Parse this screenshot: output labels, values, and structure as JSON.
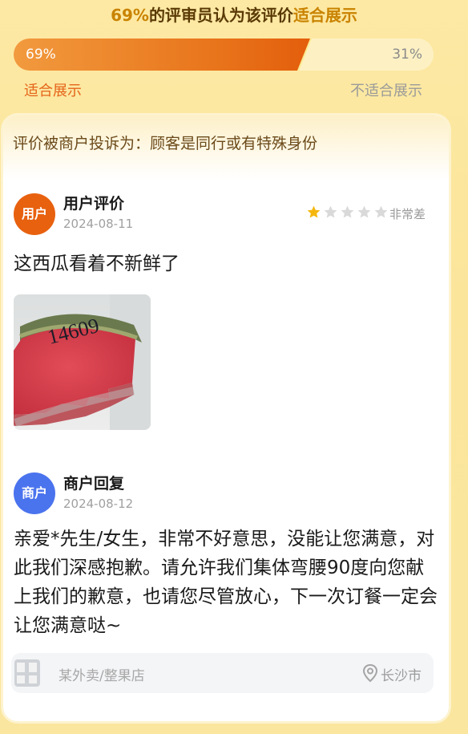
{
  "header": {
    "percent": "69%",
    "text": "的评审员认为该评价",
    "verdict": "适合展示"
  },
  "vote": {
    "suitable_percent": "69%",
    "unsuitable_percent": "31%",
    "suitable_fraction": 0.69,
    "suitable_label": "适合展示",
    "unsuitable_label": "不适合展示"
  },
  "card": {
    "complaint_text": "评价被商户投诉为：顾客是同行或有特殊身份",
    "review": {
      "avatar_label": "用户",
      "title": "用户评价",
      "date": "2024-08-11",
      "rating_stars": 1,
      "rating_max": 5,
      "rating_text": "非常差",
      "text": "这西瓜看着不新鲜了",
      "photo_handwriting": "14609"
    },
    "reply": {
      "avatar_label": "商户",
      "title": "商户回复",
      "date": "2024-08-12",
      "text": "亲爱*先生/女生，非常不好意思，没能让您满意，对此我们深感抱歉。请允许我们集体弯腰90度向您献上我们的歉意，也请您尽管放心，下一次订餐一定会让您满意哒~"
    },
    "store": {
      "name": "某外卖/整果店",
      "city": "长沙市",
      "icon": "location-pin-icon"
    }
  },
  "colors": {
    "accent_orange": "#e8610f",
    "merchant_blue": "#4a73ee",
    "star_gold": "#f5b70d"
  }
}
